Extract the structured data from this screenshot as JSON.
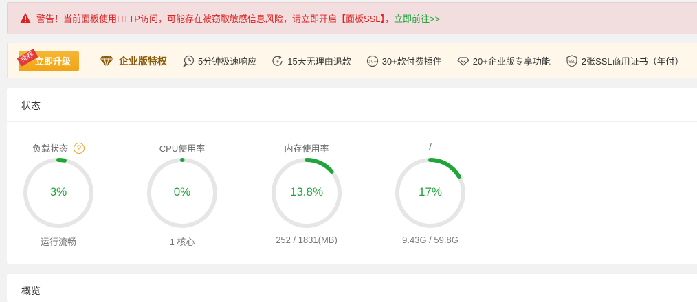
{
  "warning": {
    "text": "警告！当前面板使用HTTP访问，可能存在被窃取敏感信息风险，请立即开启【面板SSL】，",
    "link": "立即前往>>"
  },
  "promo": {
    "upgrade_tag": "推荐",
    "upgrade_label": "立即升级",
    "enterprise_title": "企业版特权",
    "features": [
      {
        "icon": "lightning-clock-icon",
        "label": "5分钟极速响应"
      },
      {
        "icon": "refund-icon",
        "label": "15天无理由退款"
      },
      {
        "icon": "plugin-30-icon",
        "label": "30+款付费插件"
      },
      {
        "icon": "diamond-outline-icon",
        "label": "20+企业版专享功能"
      },
      {
        "icon": "ssl-shield-icon",
        "label": "2张SSL商用证书（年付）"
      }
    ]
  },
  "status": {
    "title": "状态",
    "gauges": [
      {
        "label": "负载状态",
        "value": "3%",
        "percent": 3,
        "sub": "运行流畅",
        "help": "?"
      },
      {
        "label": "CPU使用率",
        "value": "0%",
        "percent": 0,
        "sub": "1 核心"
      },
      {
        "label": "内存使用率",
        "value": "13.8%",
        "percent": 13.8,
        "sub": "252 / 1831(MB)"
      },
      {
        "label": "/",
        "value": "17%",
        "percent": 17,
        "sub": "9.43G / 59.8G"
      }
    ]
  },
  "overview": {
    "title": "概览"
  },
  "colors": {
    "accent": "#20a53a",
    "track": "#e6e6e6",
    "warning": "#e02020",
    "gold": "#f0a417"
  }
}
